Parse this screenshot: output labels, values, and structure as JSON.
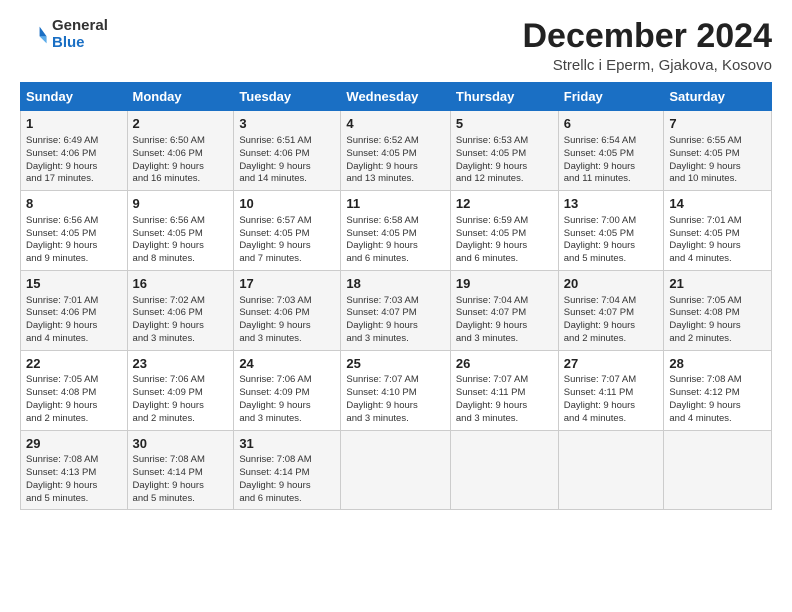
{
  "logo": {
    "general": "General",
    "blue": "Blue"
  },
  "header": {
    "month": "December 2024",
    "location": "Strellc i Eperm, Gjakova, Kosovo"
  },
  "weekdays": [
    "Sunday",
    "Monday",
    "Tuesday",
    "Wednesday",
    "Thursday",
    "Friday",
    "Saturday"
  ],
  "weeks": [
    [
      {
        "day": "1",
        "lines": [
          "Sunrise: 6:49 AM",
          "Sunset: 4:06 PM",
          "Daylight: 9 hours",
          "and 17 minutes."
        ]
      },
      {
        "day": "2",
        "lines": [
          "Sunrise: 6:50 AM",
          "Sunset: 4:06 PM",
          "Daylight: 9 hours",
          "and 16 minutes."
        ]
      },
      {
        "day": "3",
        "lines": [
          "Sunrise: 6:51 AM",
          "Sunset: 4:06 PM",
          "Daylight: 9 hours",
          "and 14 minutes."
        ]
      },
      {
        "day": "4",
        "lines": [
          "Sunrise: 6:52 AM",
          "Sunset: 4:05 PM",
          "Daylight: 9 hours",
          "and 13 minutes."
        ]
      },
      {
        "day": "5",
        "lines": [
          "Sunrise: 6:53 AM",
          "Sunset: 4:05 PM",
          "Daylight: 9 hours",
          "and 12 minutes."
        ]
      },
      {
        "day": "6",
        "lines": [
          "Sunrise: 6:54 AM",
          "Sunset: 4:05 PM",
          "Daylight: 9 hours",
          "and 11 minutes."
        ]
      },
      {
        "day": "7",
        "lines": [
          "Sunrise: 6:55 AM",
          "Sunset: 4:05 PM",
          "Daylight: 9 hours",
          "and 10 minutes."
        ]
      }
    ],
    [
      {
        "day": "8",
        "lines": [
          "Sunrise: 6:56 AM",
          "Sunset: 4:05 PM",
          "Daylight: 9 hours",
          "and 9 minutes."
        ]
      },
      {
        "day": "9",
        "lines": [
          "Sunrise: 6:56 AM",
          "Sunset: 4:05 PM",
          "Daylight: 9 hours",
          "and 8 minutes."
        ]
      },
      {
        "day": "10",
        "lines": [
          "Sunrise: 6:57 AM",
          "Sunset: 4:05 PM",
          "Daylight: 9 hours",
          "and 7 minutes."
        ]
      },
      {
        "day": "11",
        "lines": [
          "Sunrise: 6:58 AM",
          "Sunset: 4:05 PM",
          "Daylight: 9 hours",
          "and 6 minutes."
        ]
      },
      {
        "day": "12",
        "lines": [
          "Sunrise: 6:59 AM",
          "Sunset: 4:05 PM",
          "Daylight: 9 hours",
          "and 6 minutes."
        ]
      },
      {
        "day": "13",
        "lines": [
          "Sunrise: 7:00 AM",
          "Sunset: 4:05 PM",
          "Daylight: 9 hours",
          "and 5 minutes."
        ]
      },
      {
        "day": "14",
        "lines": [
          "Sunrise: 7:01 AM",
          "Sunset: 4:05 PM",
          "Daylight: 9 hours",
          "and 4 minutes."
        ]
      }
    ],
    [
      {
        "day": "15",
        "lines": [
          "Sunrise: 7:01 AM",
          "Sunset: 4:06 PM",
          "Daylight: 9 hours",
          "and 4 minutes."
        ]
      },
      {
        "day": "16",
        "lines": [
          "Sunrise: 7:02 AM",
          "Sunset: 4:06 PM",
          "Daylight: 9 hours",
          "and 3 minutes."
        ]
      },
      {
        "day": "17",
        "lines": [
          "Sunrise: 7:03 AM",
          "Sunset: 4:06 PM",
          "Daylight: 9 hours",
          "and 3 minutes."
        ]
      },
      {
        "day": "18",
        "lines": [
          "Sunrise: 7:03 AM",
          "Sunset: 4:07 PM",
          "Daylight: 9 hours",
          "and 3 minutes."
        ]
      },
      {
        "day": "19",
        "lines": [
          "Sunrise: 7:04 AM",
          "Sunset: 4:07 PM",
          "Daylight: 9 hours",
          "and 3 minutes."
        ]
      },
      {
        "day": "20",
        "lines": [
          "Sunrise: 7:04 AM",
          "Sunset: 4:07 PM",
          "Daylight: 9 hours",
          "and 2 minutes."
        ]
      },
      {
        "day": "21",
        "lines": [
          "Sunrise: 7:05 AM",
          "Sunset: 4:08 PM",
          "Daylight: 9 hours",
          "and 2 minutes."
        ]
      }
    ],
    [
      {
        "day": "22",
        "lines": [
          "Sunrise: 7:05 AM",
          "Sunset: 4:08 PM",
          "Daylight: 9 hours",
          "and 2 minutes."
        ]
      },
      {
        "day": "23",
        "lines": [
          "Sunrise: 7:06 AM",
          "Sunset: 4:09 PM",
          "Daylight: 9 hours",
          "and 2 minutes."
        ]
      },
      {
        "day": "24",
        "lines": [
          "Sunrise: 7:06 AM",
          "Sunset: 4:09 PM",
          "Daylight: 9 hours",
          "and 3 minutes."
        ]
      },
      {
        "day": "25",
        "lines": [
          "Sunrise: 7:07 AM",
          "Sunset: 4:10 PM",
          "Daylight: 9 hours",
          "and 3 minutes."
        ]
      },
      {
        "day": "26",
        "lines": [
          "Sunrise: 7:07 AM",
          "Sunset: 4:11 PM",
          "Daylight: 9 hours",
          "and 3 minutes."
        ]
      },
      {
        "day": "27",
        "lines": [
          "Sunrise: 7:07 AM",
          "Sunset: 4:11 PM",
          "Daylight: 9 hours",
          "and 4 minutes."
        ]
      },
      {
        "day": "28",
        "lines": [
          "Sunrise: 7:08 AM",
          "Sunset: 4:12 PM",
          "Daylight: 9 hours",
          "and 4 minutes."
        ]
      }
    ],
    [
      {
        "day": "29",
        "lines": [
          "Sunrise: 7:08 AM",
          "Sunset: 4:13 PM",
          "Daylight: 9 hours",
          "and 5 minutes."
        ]
      },
      {
        "day": "30",
        "lines": [
          "Sunrise: 7:08 AM",
          "Sunset: 4:14 PM",
          "Daylight: 9 hours",
          "and 5 minutes."
        ]
      },
      {
        "day": "31",
        "lines": [
          "Sunrise: 7:08 AM",
          "Sunset: 4:14 PM",
          "Daylight: 9 hours",
          "and 6 minutes."
        ]
      },
      null,
      null,
      null,
      null
    ]
  ]
}
